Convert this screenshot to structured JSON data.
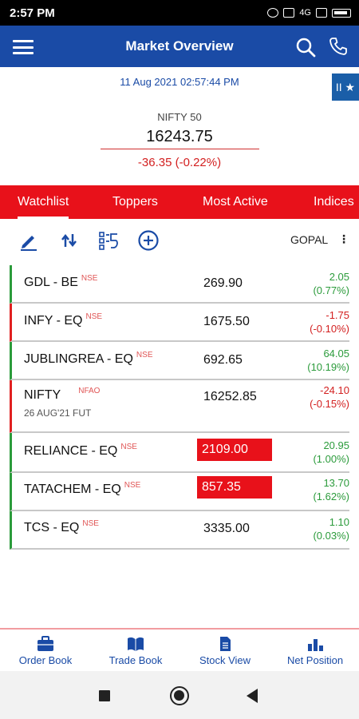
{
  "status": {
    "time": "2:57 PM",
    "network": "4G"
  },
  "appbar": {
    "title": "Market Overview"
  },
  "side_tab": {
    "label": "II ★"
  },
  "overview": {
    "datetime": "11 Aug 2021 02:57:44 PM",
    "index_name": "NIFTY 50",
    "index_value": "16243.75",
    "index_change": "-36.35 (-0.22%)"
  },
  "tabs": [
    "Watchlist",
    "Toppers",
    "Most Active",
    "Indices"
  ],
  "toolbar": {
    "watchlist_name": "GOPAL",
    "more": "⋮"
  },
  "watchlist": [
    {
      "symbol": "GDL  - BE",
      "exchange": "NSE",
      "sub": "",
      "ltp": "269.90",
      "change": "2.05",
      "pct": "(0.77%)",
      "dir": "up",
      "highlight": false
    },
    {
      "symbol": "INFY  - EQ",
      "exchange": "NSE",
      "sub": "",
      "ltp": "1675.50",
      "change": "-1.75",
      "pct": "(-0.10%)",
      "dir": "down",
      "highlight": false
    },
    {
      "symbol": "JUBLINGREA  - EQ",
      "exchange": "NSE",
      "sub": "",
      "ltp": "692.65",
      "change": "64.05",
      "pct": "(10.19%)",
      "dir": "up",
      "highlight": false
    },
    {
      "symbol": "NIFTY",
      "exchange": "NFAO",
      "sub": "26 AUG'21 FUT",
      "ltp": "16252.85",
      "change": "-24.10",
      "pct": "(-0.15%)",
      "dir": "down",
      "highlight": false
    },
    {
      "symbol": "RELIANCE  - EQ",
      "exchange": "NSE",
      "sub": "",
      "ltp": "2109.00",
      "change": "20.95",
      "pct": "(1.00%)",
      "dir": "up",
      "highlight": true
    },
    {
      "symbol": "TATACHEM  - EQ",
      "exchange": "NSE",
      "sub": "",
      "ltp": "857.35",
      "change": "13.70",
      "pct": "(1.62%)",
      "dir": "up",
      "highlight": true
    },
    {
      "symbol": "TCS  - EQ",
      "exchange": "NSE",
      "sub": "",
      "ltp": "3335.00",
      "change": "1.10",
      "pct": "(0.03%)",
      "dir": "up",
      "highlight": false
    }
  ],
  "bottom_nav": [
    "Order Book",
    "Trade Book",
    "Stock View",
    "Net Position"
  ],
  "colors": {
    "primary": "#1a4ba6",
    "accent": "#e8111a",
    "up": "#2b9b3b",
    "down": "#d32020"
  }
}
